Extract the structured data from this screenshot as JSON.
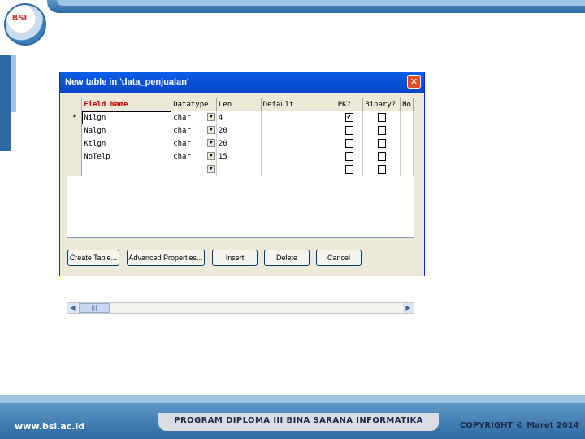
{
  "slide": {
    "logo_text": "BSI",
    "footer_left": "www.bsi.ac.id",
    "footer_center": "PROGRAM DIPLOMA III BINA SARANA INFORMATIKA",
    "footer_right": "COPYRIGHT © Maret 2014"
  },
  "dialog": {
    "title": "New table in 'data_penjualan'",
    "close_symbol": "✕",
    "columns": [
      "Field Name",
      "Datatype",
      "Len",
      "Default",
      "PK?",
      "Binary?",
      "No"
    ],
    "rows": [
      {
        "marker": "*",
        "field": "Nilgn",
        "datatype": "char",
        "len": "4",
        "default": "",
        "pk": "✔",
        "binary": ""
      },
      {
        "marker": "",
        "field": "Nalgn",
        "datatype": "char",
        "len": "20",
        "default": "",
        "pk": "",
        "binary": ""
      },
      {
        "marker": "",
        "field": "Ktlgn",
        "datatype": "char",
        "len": "20",
        "default": "",
        "pk": "",
        "binary": ""
      },
      {
        "marker": "",
        "field": "NoTelp",
        "datatype": "char",
        "len": "15",
        "default": "",
        "pk": "",
        "binary": ""
      },
      {
        "marker": "",
        "field": "",
        "datatype": "",
        "len": "",
        "default": "",
        "pk": "",
        "binary": ""
      }
    ],
    "scroll_left": "◀",
    "scroll_right": "▶",
    "scroll_thumb": "|||",
    "buttons": {
      "create": "Create Table...",
      "advanced": "Advanced Properties...",
      "insert": "Insert",
      "delete": "Delete",
      "cancel": "Cancel"
    }
  }
}
